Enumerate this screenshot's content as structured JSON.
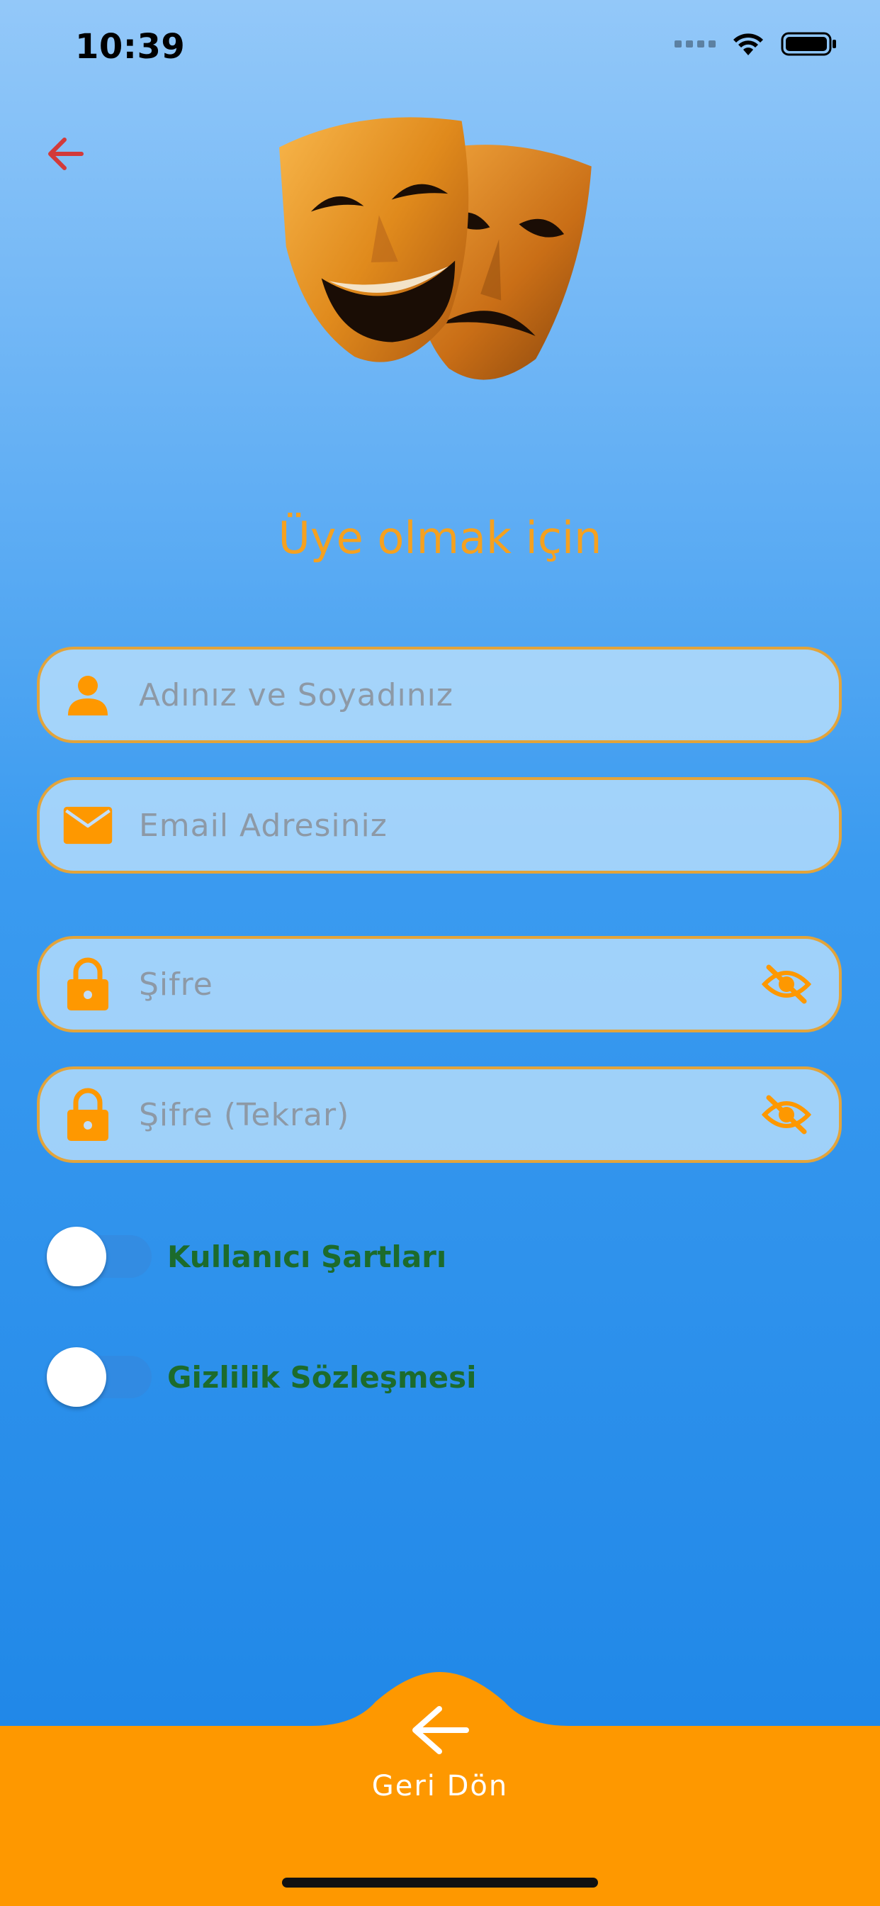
{
  "status_bar": {
    "time": "10:39"
  },
  "header": {
    "back_icon": "arrow-left-icon",
    "logo": "theater-masks-image"
  },
  "title": "Üye olmak için",
  "form": {
    "name": {
      "placeholder": "Adınız ve Soyadınız",
      "value": "",
      "icon": "person-icon"
    },
    "email": {
      "placeholder": "Email Adresiniz",
      "value": "",
      "icon": "envelope-icon"
    },
    "password": {
      "placeholder": "Şifre",
      "value": "",
      "icon": "lock-icon",
      "toggle_icon": "eye-off-icon"
    },
    "password_repeat": {
      "placeholder": "Şifre (Tekrar)",
      "value": "",
      "icon": "lock-icon",
      "toggle_icon": "eye-off-icon"
    }
  },
  "toggles": [
    {
      "label": "Kullanıcı Şartları",
      "on": false
    },
    {
      "label": "Gizlilik Sözleşmesi",
      "on": false
    }
  ],
  "bottom_nav": {
    "label": "Geri Dön",
    "icon": "arrow-left-icon"
  },
  "colors": {
    "accent_orange": "#fe9800",
    "title_orange": "#f5a11f",
    "label_green": "#1c6b2c",
    "back_red": "#d23a3a"
  }
}
